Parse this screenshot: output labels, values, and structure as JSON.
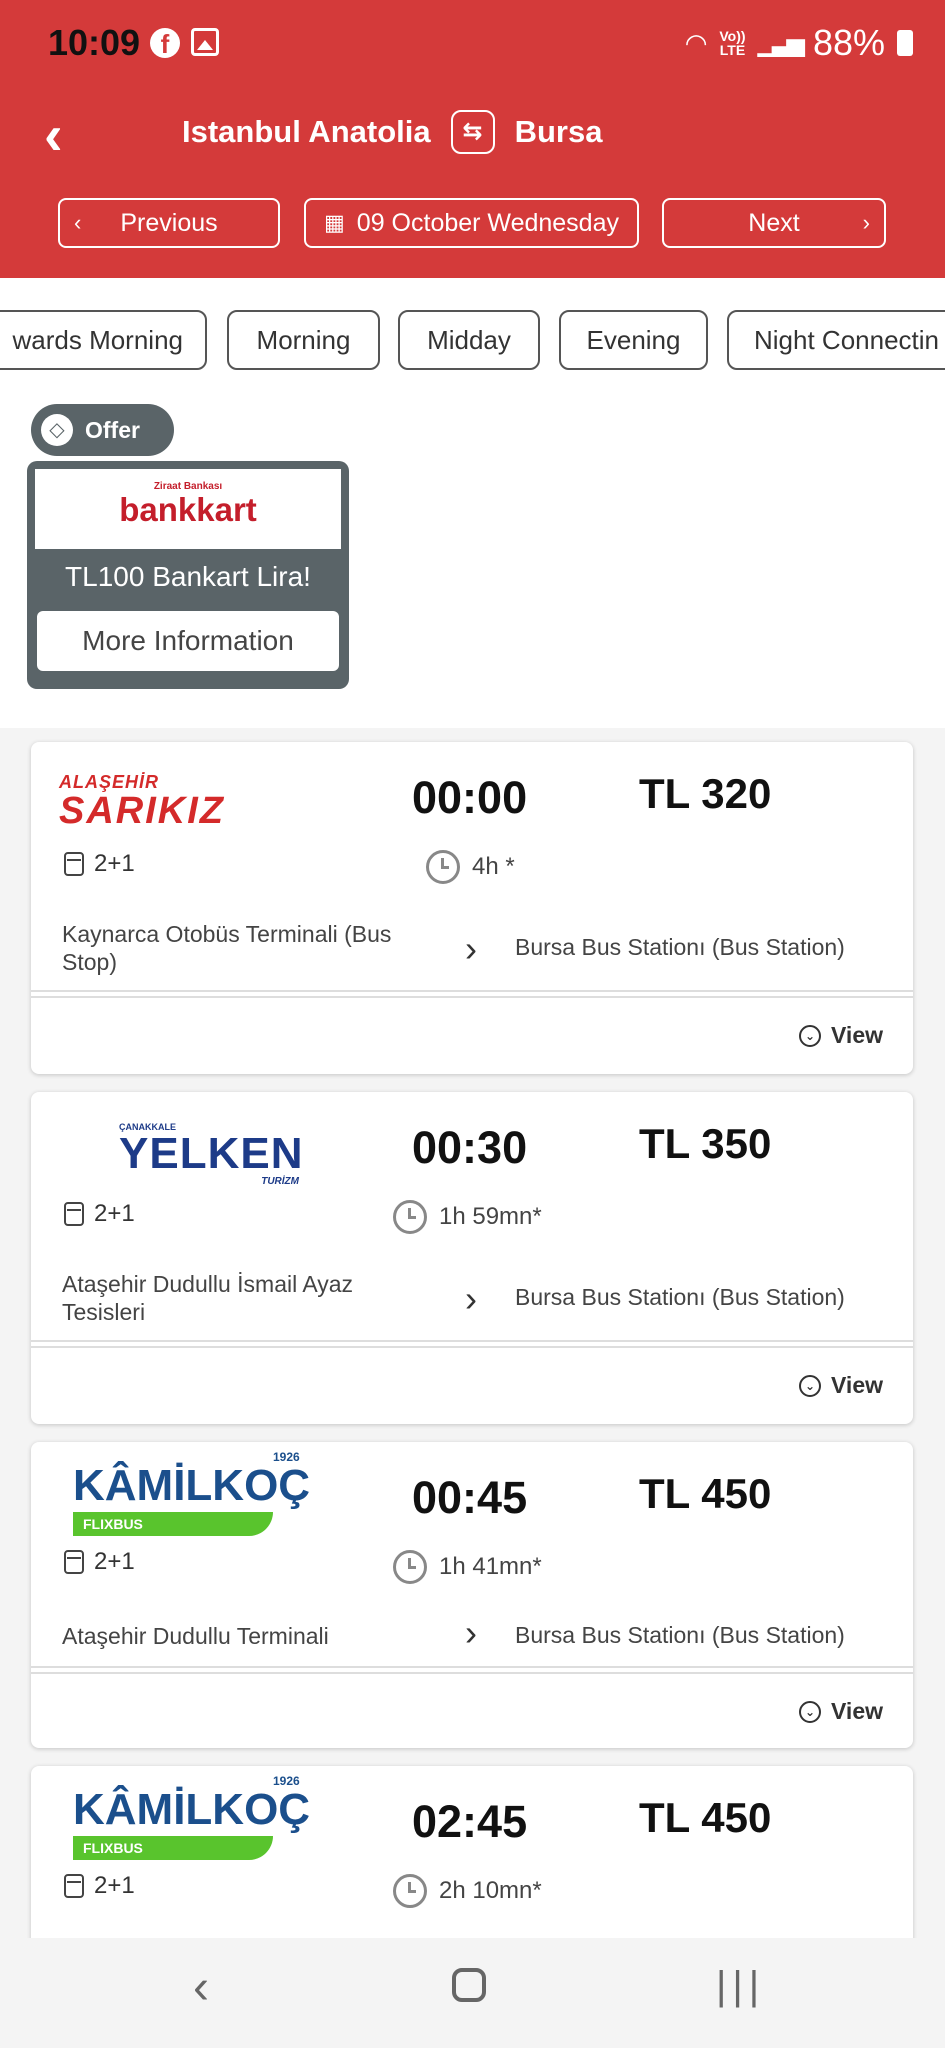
{
  "status": {
    "time": "10:09",
    "battery": "88%",
    "lte_top": "Vo))",
    "lte_bottom": "LTE"
  },
  "header": {
    "origin": "Istanbul Anatolia",
    "destination": "Bursa",
    "prev_label": "Previous",
    "date_label": "09 October Wednesday",
    "next_label": "Next"
  },
  "filters": [
    "wards Morning",
    "Morning",
    "Midday",
    "Evening",
    "Night Connectin"
  ],
  "offer": {
    "badge": "Offer",
    "logo_sub": "Ziraat Bankası",
    "logo_main": "bankkart",
    "text": "TL100 Bankart Lira!",
    "button": "More Information"
  },
  "trips": [
    {
      "logo_top": "ALAŞEHİR",
      "logo_main": "SARIKIZ",
      "seat": "2+1",
      "time": "00:00",
      "price": "TL 320",
      "duration": "4h *",
      "from": "Kaynarca Otobüs Terminali (Bus Stop)",
      "to": "Bursa Bus Stationı (Bus Station)",
      "view": "View"
    },
    {
      "logo_top": "ÇANAKKALE",
      "logo_main": "YELKEN",
      "logo_bottom": "TURİZM",
      "seat": "2+1",
      "time": "00:30",
      "price": "TL 350",
      "duration": "1h 59mn*",
      "from": "Ataşehir Dudullu İsmail Ayaz Tesisleri",
      "to": "Bursa Bus Stationı (Bus Station)",
      "view": "View"
    },
    {
      "logo_main": "KÂMİLKOÇ",
      "logo_year": "1926",
      "logo_bar": "FLIXBUS",
      "seat": "2+1",
      "time": "00:45",
      "price": "TL 450",
      "duration": "1h 41mn*",
      "from": "Ataşehir Dudullu Terminali",
      "to": "Bursa Bus Stationı (Bus Station)",
      "view": "View"
    },
    {
      "logo_main": "KÂMİLKOÇ",
      "logo_year": "1926",
      "logo_bar": "FLIXBUS",
      "seat": "2+1",
      "time": "02:45",
      "price": "TL 450",
      "duration": "2h 10mn*"
    }
  ]
}
